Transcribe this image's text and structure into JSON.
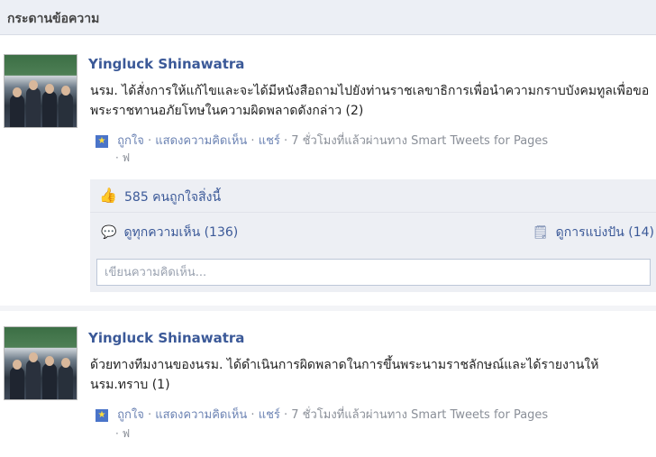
{
  "header": {
    "title": "กระดานข้อความ"
  },
  "posts": [
    {
      "author": "Yingluck Shinawatra",
      "message": "นรม. ได้สั่งการให้แก้ไขและจะได้มีหนังสือถามไปยังท่านราชเลขาธิการเพื่อนำความกราบบังคมทูลเพื่อขอพระราชทานอภัยโทษในความผิดพลาดดังกล่าว (2)",
      "meta_like": "ถูกใจ",
      "meta_comment": "แสดงความคิดเห็น",
      "meta_share": "แชร์",
      "meta_time": "7 ชั่วโมงที่แล้วผ่านทาง Smart Tweets for Pages",
      "meta_extra": "· ฟ",
      "likes_text": "585 คนถูกใจสิ่งนี้",
      "comments_text": "ดูทุกความเห็น (136)",
      "shares_text": "ดูการแบ่งปัน (14)",
      "comment_placeholder": "เขียนความคิดเห็น..."
    },
    {
      "author": "Yingluck Shinawatra",
      "message": "ด้วยทางทีมงานของนรม. ได้ดำเนินการผิดพลาดในการขึ้นพระนามราชลักษณ์และได้รายงานให้นรม.ทราบ (1)",
      "meta_like": "ถูกใจ",
      "meta_comment": "แสดงความคิดเห็น",
      "meta_share": "แชร์",
      "meta_time": "7 ชั่วโมงที่แล้วผ่านทาง Smart Tweets for Pages",
      "meta_extra": "· ฟ"
    }
  ]
}
